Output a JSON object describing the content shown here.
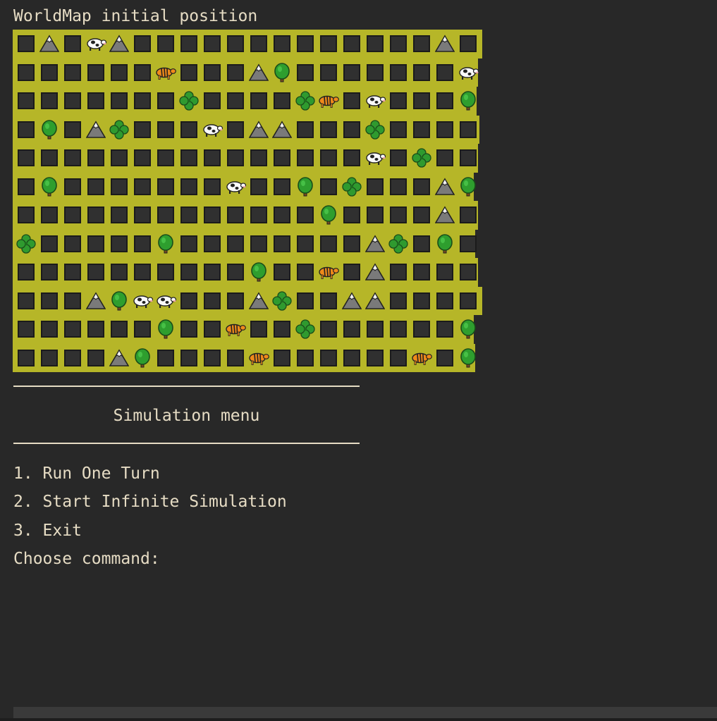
{
  "map": {
    "title": "WorldMap initial position",
    "rows": [
      [
        "empty",
        "mountain",
        "empty",
        "cow",
        "mountain",
        "empty",
        "empty",
        "empty",
        "empty",
        "empty",
        "empty",
        "empty",
        "empty",
        "empty",
        "empty",
        "empty",
        "empty",
        "empty",
        "mountain",
        "empty"
      ],
      [
        "empty",
        "empty",
        "empty",
        "empty",
        "empty",
        "empty",
        "tiger",
        "empty",
        "empty",
        "empty",
        "mountain",
        "tree",
        "empty",
        "empty",
        "empty",
        "empty",
        "empty",
        "empty",
        "empty",
        "cow"
      ],
      [
        "empty",
        "empty",
        "empty",
        "empty",
        "empty",
        "empty",
        "empty",
        "clover",
        "empty",
        "empty",
        "empty",
        "empty",
        "clover",
        "tiger",
        "empty",
        "cow",
        "empty",
        "empty",
        "empty",
        "tree"
      ],
      [
        "empty",
        "tree",
        "empty",
        "mountain",
        "clover",
        "empty",
        "empty",
        "empty",
        "cow",
        "empty",
        "mountain",
        "mountain",
        "empty",
        "empty",
        "empty",
        "clover",
        "empty",
        "empty",
        "empty",
        "empty"
      ],
      [
        "empty",
        "empty",
        "empty",
        "empty",
        "empty",
        "empty",
        "empty",
        "empty",
        "empty",
        "empty",
        "empty",
        "empty",
        "empty",
        "empty",
        "empty",
        "cow",
        "empty",
        "clover",
        "empty",
        "empty"
      ],
      [
        "empty",
        "tree",
        "empty",
        "empty",
        "empty",
        "empty",
        "empty",
        "empty",
        "empty",
        "cow",
        "empty",
        "empty",
        "tree",
        "empty",
        "clover",
        "empty",
        "empty",
        "empty",
        "mountain",
        "tree"
      ],
      [
        "empty",
        "empty",
        "empty",
        "empty",
        "empty",
        "empty",
        "empty",
        "empty",
        "empty",
        "empty",
        "empty",
        "empty",
        "empty",
        "tree",
        "empty",
        "empty",
        "empty",
        "empty",
        "mountain",
        "empty"
      ],
      [
        "clover",
        "empty",
        "empty",
        "empty",
        "empty",
        "empty",
        "tree",
        "empty",
        "empty",
        "empty",
        "empty",
        "empty",
        "empty",
        "empty",
        "empty",
        "mountain",
        "clover",
        "empty",
        "tree",
        "empty"
      ],
      [
        "empty",
        "empty",
        "empty",
        "empty",
        "empty",
        "empty",
        "empty",
        "empty",
        "empty",
        "empty",
        "tree",
        "empty",
        "empty",
        "tiger",
        "empty",
        "mountain",
        "empty",
        "empty",
        "empty",
        "empty"
      ],
      [
        "empty",
        "empty",
        "empty",
        "mountain",
        "tree",
        "cow",
        "cow",
        "empty",
        "empty",
        "empty",
        "mountain",
        "clover",
        "empty",
        "empty",
        "mountain",
        "mountain",
        "empty",
        "empty",
        "empty",
        "empty"
      ],
      [
        "empty",
        "empty",
        "empty",
        "empty",
        "empty",
        "empty",
        "tree",
        "empty",
        "empty",
        "tiger",
        "empty",
        "empty",
        "clover",
        "empty",
        "empty",
        "empty",
        "empty",
        "empty",
        "empty",
        "tree"
      ],
      [
        "empty",
        "empty",
        "empty",
        "empty",
        "mountain",
        "tree",
        "empty",
        "empty",
        "empty",
        "empty",
        "tiger",
        "empty",
        "empty",
        "empty",
        "empty",
        "empty",
        "empty",
        "tiger",
        "empty",
        "tree"
      ]
    ]
  },
  "menu": {
    "title": "Simulation menu",
    "items": [
      "1. Run One Turn",
      "2. Start Infinite Simulation",
      "3. Exit"
    ],
    "prompt": "Choose command:"
  },
  "colors": {
    "background": "#282828",
    "text": "#e6dcc4",
    "map_background": "#b6b628",
    "empty_cell": "#303030"
  },
  "icons": {
    "empty": "empty-cell-icon",
    "mountain": "mountain-icon",
    "tree": "tree-icon",
    "clover": "clover-icon",
    "cow": "cow-icon",
    "tiger": "tiger-icon"
  }
}
